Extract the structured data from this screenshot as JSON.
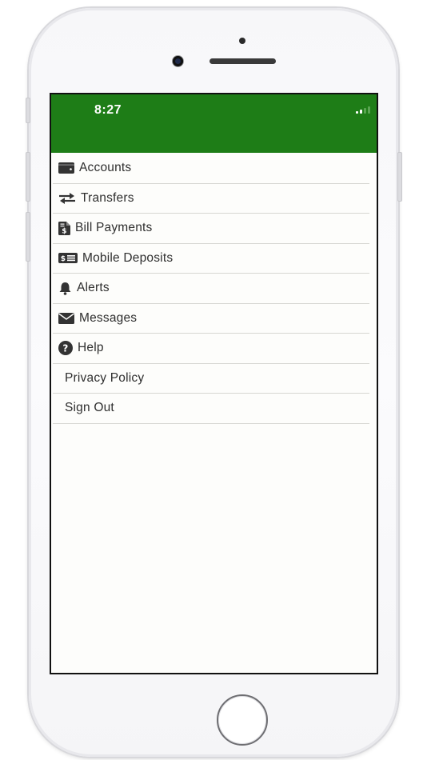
{
  "status_bar": {
    "time": "8:27",
    "background_color": "#1e7d17",
    "signal_icon": "cellular-signal-icon"
  },
  "menu": {
    "items": [
      {
        "id": "accounts",
        "label": "Accounts",
        "icon": "wallet-icon"
      },
      {
        "id": "transfers",
        "label": "Transfers",
        "icon": "exchange-arrows-icon"
      },
      {
        "id": "bill-payments",
        "label": "Bill Payments",
        "icon": "invoice-dollar-icon"
      },
      {
        "id": "mobile-deposits",
        "label": "Mobile Deposits",
        "icon": "money-bill-icon"
      },
      {
        "id": "alerts",
        "label": "Alerts",
        "icon": "bell-icon"
      },
      {
        "id": "messages",
        "label": "Messages",
        "icon": "envelope-icon"
      },
      {
        "id": "help",
        "label": "Help",
        "icon": "question-circle-icon"
      },
      {
        "id": "privacy-policy",
        "label": "Privacy Policy",
        "icon": ""
      },
      {
        "id": "sign-out",
        "label": "Sign Out",
        "icon": ""
      }
    ]
  },
  "device": {
    "home_button_icon": "home-button-icon"
  }
}
